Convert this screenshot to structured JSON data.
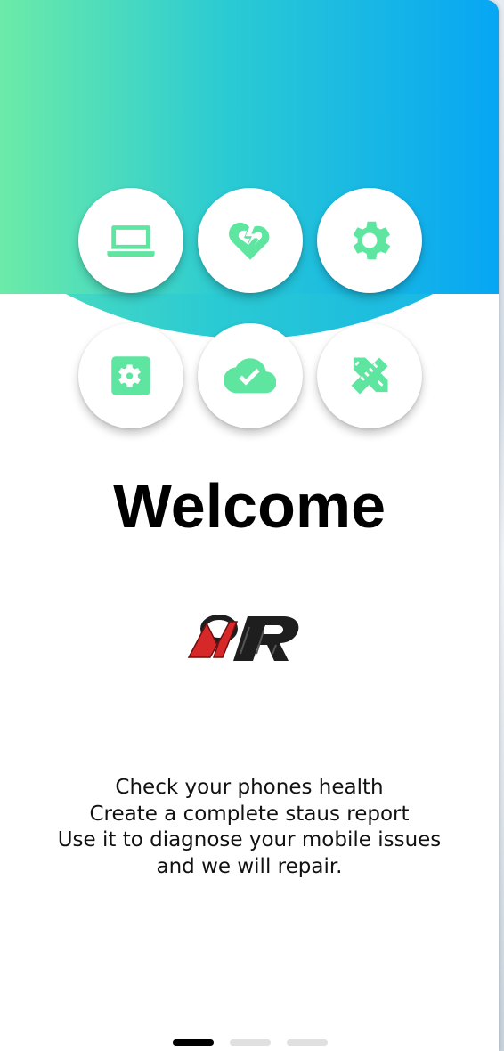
{
  "icons": [
    {
      "name": "laptop-icon"
    },
    {
      "name": "broken-heart-icon"
    },
    {
      "name": "gear-icon"
    },
    {
      "name": "settings-box-icon"
    },
    {
      "name": "cloud-check-icon"
    },
    {
      "name": "ruler-pencil-icon"
    }
  ],
  "welcome": {
    "title": "Welcome",
    "logo_text": "MR",
    "description": [
      "Check your phones health",
      "Create a complete staus report",
      "Use it to diagnose your mobile issues",
      "and we will repair."
    ]
  },
  "pager": {
    "count": 3,
    "active_index": 0
  },
  "colors": {
    "gradient_start": "#6ceba8",
    "gradient_mid": "#2bcbd3",
    "gradient_end": "#07a6f4",
    "icon_green": "#5ee6a0",
    "logo_red": "#d62828",
    "logo_dark": "#1e1e1e"
  }
}
